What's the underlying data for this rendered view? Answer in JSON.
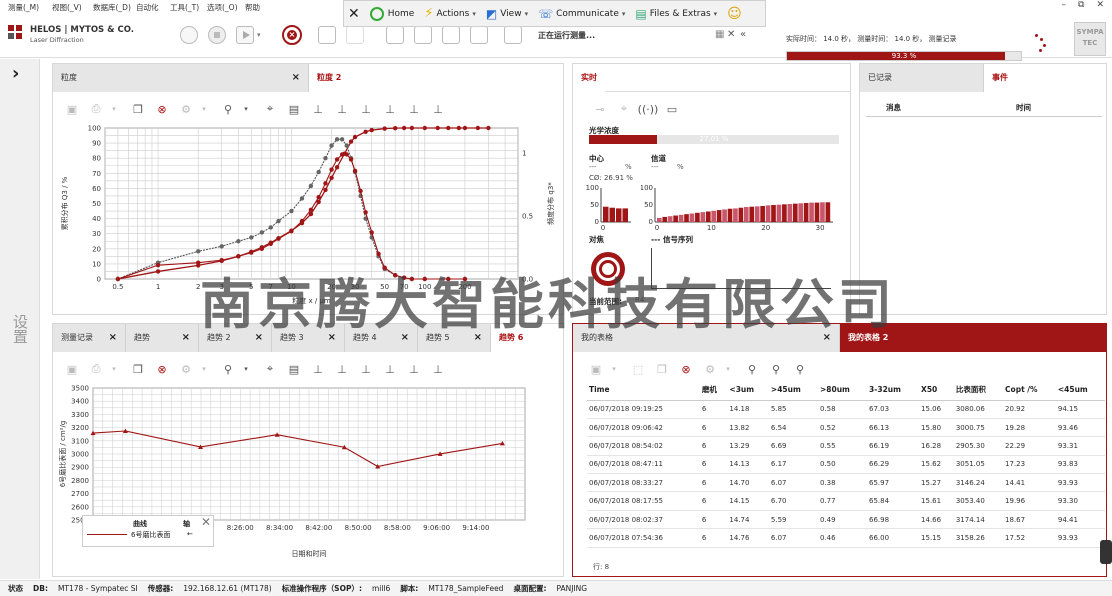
{
  "menu": [
    "测量(_M)",
    "视图(_V)",
    "数据库(_D)",
    "自动化",
    "工具(_T)",
    "选项(_O)",
    "帮助"
  ],
  "window_controls": [
    "–",
    "⧉",
    "✕"
  ],
  "floatbar": {
    "close": "✕",
    "home": "Home",
    "actions": "Actions",
    "view": "View",
    "communicate": "Communicate",
    "files": "Files & Extras",
    "smiley": "☺"
  },
  "brand": {
    "name": "HELOS | MYTOS & CO.",
    "sub": "Laser Diffraction",
    "logo_right": "SYMPA TEC"
  },
  "running_text": "正在运行测量...",
  "time_info": "实际时间： 14.0 秒， 测量时间： 14.0 秒， 测量记录",
  "progress": {
    "value": 0.933,
    "label": "93.3 %"
  },
  "left_strip": {
    "arrow": "›",
    "label": "设置"
  },
  "panel_size": {
    "tabs": [
      {
        "label": "粒度"
      },
      {
        "label": "粒度 2"
      }
    ],
    "close": "×"
  },
  "panel_realtime": {
    "tab": "实时",
    "optical_label": "光学浓度",
    "optical": {
      "value": 0.2701,
      "label": "27.01 %"
    },
    "center_label": "中心",
    "center_val": "---",
    "center_unit": "%",
    "channel_label": "信道",
    "channel_val": "---",
    "channel_unit": "%",
    "c0": "CØ: 26.91 %",
    "align_label": "对焦",
    "signal_label": "---  信号序列",
    "range_label": "当前范围:",
    "range_val": "R4"
  },
  "panel_events": {
    "tabs": [
      "已记录",
      "事件"
    ],
    "col_msg": "消息",
    "col_time": "时间"
  },
  "panel_trend": {
    "tabs": [
      "测量记录",
      "趋势",
      "趋势 2",
      "趋势 3",
      "趋势 4",
      "趋势 5",
      "趋势 6"
    ],
    "legend_col1": "曲线",
    "legend_col2": "轴",
    "legend_item": "6号磨比表面",
    "legend_arrow": "←"
  },
  "panel_table": {
    "tabs": [
      "我的表格",
      "我的表格 2"
    ],
    "columns": [
      "Time",
      "磨机",
      "<3um",
      ">45um",
      ">80um",
      "3-32um",
      "X50",
      "比表面积",
      "Copt /%",
      "<45um"
    ],
    "rows": [
      [
        "06/07/2018 09:19:25",
        "6",
        "14.18",
        "5.85",
        "0.58",
        "67.03",
        "15.06",
        "3080.06",
        "20.92",
        "94.15"
      ],
      [
        "06/07/2018 09:06:42",
        "6",
        "13.82",
        "6.54",
        "0.52",
        "66.13",
        "15.80",
        "3000.75",
        "19.28",
        "93.46"
      ],
      [
        "06/07/2018 08:54:02",
        "6",
        "13.29",
        "6.69",
        "0.55",
        "66.19",
        "16.28",
        "2905.30",
        "22.29",
        "93.31"
      ],
      [
        "06/07/2018 08:47:11",
        "6",
        "14.13",
        "6.17",
        "0.50",
        "66.29",
        "15.62",
        "3051.05",
        "17.23",
        "93.83"
      ],
      [
        "06/07/2018 08:33:27",
        "6",
        "14.70",
        "6.07",
        "0.38",
        "65.97",
        "15.27",
        "3146.24",
        "14.41",
        "93.93"
      ],
      [
        "06/07/2018 08:17:55",
        "6",
        "14.15",
        "6.70",
        "0.77",
        "65.84",
        "15.61",
        "3053.40",
        "19.96",
        "93.30"
      ],
      [
        "06/07/2018 08:02:37",
        "6",
        "14.74",
        "5.59",
        "0.49",
        "66.98",
        "14.66",
        "3174.14",
        "18.67",
        "94.41"
      ],
      [
        "06/07/2018 07:54:36",
        "6",
        "14.76",
        "6.07",
        "0.46",
        "66.00",
        "15.15",
        "3158.26",
        "17.52",
        "93.93"
      ]
    ],
    "rowcount": "行:  8"
  },
  "status": {
    "label": "状态",
    "db_label": "DB:",
    "db": "MT178 - Sympatec SI",
    "sensor_label": "传感器:",
    "sensor": "192.168.12.61 (MT178)",
    "sop_label": "标准操作程序（SOP）:",
    "sop": "mill6",
    "script_label": "脚本:",
    "script": "MT178_SampleFeed",
    "desk_label": "桌面配置:",
    "desk": "PANJING"
  },
  "watermark": "南京腾大智能科技有限公司",
  "colors": {
    "accent": "#a01515",
    "grid": "#cccccc"
  },
  "chart_data": [
    {
      "type": "line",
      "title": "",
      "xlabel": "粒度 x / µm",
      "ylabel": "累积分布 Q3 / %",
      "y2label": "频度分布 q3*",
      "xscale": "log",
      "xlim": [
        0.4,
        500
      ],
      "ylim": [
        0,
        100
      ],
      "y2lim": [
        0,
        1.2
      ],
      "xticks": [
        0.5,
        1,
        2,
        3,
        5,
        7,
        10,
        20,
        30,
        50,
        70,
        100,
        200
      ],
      "yticks": [
        0,
        10,
        20,
        30,
        40,
        50,
        60,
        70,
        80,
        90,
        100
      ],
      "y2ticks": [
        0,
        0.5,
        1.0
      ],
      "series": [
        {
          "x": [
            0.5,
            1,
            2,
            3,
            4,
            5,
            6,
            7,
            8,
            10,
            12,
            14,
            16,
            18,
            20,
            22,
            25,
            28,
            30,
            36,
            40,
            50,
            60,
            70,
            80,
            100,
            125,
            150,
            180,
            200,
            250,
            300
          ],
          "y": [
            0,
            5,
            9,
            12,
            15,
            18,
            21,
            24,
            27,
            32,
            37,
            43,
            51,
            59,
            67,
            74,
            83,
            91,
            94,
            97.5,
            98.6,
            99.6,
            99.9,
            100,
            100,
            100,
            100,
            100,
            100,
            100,
            100,
            100
          ]
        },
        {
          "x": [
            0.5,
            1,
            2,
            3,
            4,
            5,
            6,
            7,
            8,
            10,
            12,
            14,
            16,
            18,
            20,
            22,
            24,
            26,
            28,
            30,
            33,
            36,
            40,
            45,
            50,
            60,
            70,
            80,
            100,
            150,
            200
          ],
          "y2": [
            0,
            0.13,
            0.22,
            0.26,
            0.3,
            0.33,
            0.37,
            0.41,
            0.46,
            0.54,
            0.64,
            0.74,
            0.85,
            0.96,
            1.06,
            1.11,
            1.11,
            1.06,
            0.96,
            0.85,
            0.66,
            0.48,
            0.33,
            0.18,
            0.08,
            0.03,
            0.01,
            0,
            0,
            0,
            0
          ]
        },
        {
          "x": [
            0.5,
            1,
            2,
            3,
            4,
            5,
            6,
            7,
            8,
            10,
            12,
            14,
            16,
            18,
            20,
            22,
            24,
            26,
            28,
            30,
            33,
            36,
            40,
            45,
            50,
            60,
            70,
            80,
            100,
            150,
            200
          ],
          "y2": [
            0,
            0.11,
            0.13,
            0.15,
            0.18,
            0.21,
            0.24,
            0.28,
            0.32,
            0.38,
            0.46,
            0.55,
            0.65,
            0.76,
            0.87,
            0.95,
            0.99,
            0.99,
            0.95,
            0.86,
            0.7,
            0.53,
            0.37,
            0.2,
            0.09,
            0.03,
            0.01,
            0,
            0,
            0,
            0
          ]
        }
      ]
    },
    {
      "type": "line",
      "title": "",
      "xlabel": "日期和时间",
      "ylabel": "6号磨比表面 / cm²/g",
      "ylim": [
        2500,
        3500
      ],
      "yticks": [
        2500,
        2600,
        2700,
        2800,
        2900,
        3000,
        3100,
        3200,
        3300,
        3400,
        3500
      ],
      "xticks": [
        "8:18:00",
        "8:26:00",
        "8:34:00",
        "8:42:00",
        "8:50:00",
        "8:58:00",
        "9:06:00",
        "9:14:00"
      ],
      "xlim_minutes": [
        476,
        564
      ],
      "series": [
        {
          "name": "6号磨比表面",
          "x_minutes": [
            474.6,
            482.6,
            497.9,
            513.5,
            527.2,
            534.0,
            546.7,
            559.4
          ],
          "y": [
            3158.26,
            3174.14,
            3053.4,
            3146.24,
            3051.05,
            2905.3,
            3000.75,
            3080.06
          ]
        }
      ]
    },
    {
      "type": "bar",
      "title": "",
      "xticks": [
        0,
        10,
        20,
        30
      ],
      "yticks": [
        0,
        50,
        100
      ],
      "ylim": [
        0,
        100
      ],
      "values": [
        12,
        15,
        17,
        19,
        21,
        23,
        25,
        27,
        29,
        31,
        33,
        35,
        37,
        39,
        40,
        42,
        44,
        45,
        46,
        47,
        49,
        50,
        51,
        52,
        53,
        54,
        55,
        56,
        57,
        57,
        58,
        58
      ],
      "highlight": [
        0,
        2,
        4,
        6,
        8,
        10,
        12,
        14,
        16,
        18,
        20,
        22,
        24,
        26,
        28,
        30
      ]
    },
    {
      "type": "bar",
      "title": "",
      "yticks": [
        0,
        50,
        100
      ],
      "ylim": [
        0,
        100
      ],
      "values": [
        45,
        42,
        40,
        40
      ]
    }
  ]
}
